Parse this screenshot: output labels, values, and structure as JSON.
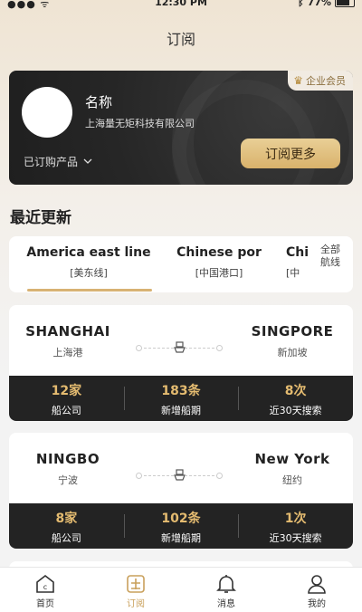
{
  "status_bar": {
    "time": "12:30 PM",
    "battery": "77%"
  },
  "nav": {
    "title": "订阅"
  },
  "member": {
    "badge": "企业会员",
    "name": "名称",
    "company": "上海量无矩科技有限公司",
    "purchased_label": "已订购产品",
    "subscribe_button": "订阅更多"
  },
  "recent": {
    "title": "最近更新",
    "tabs": [
      {
        "en": "America east line",
        "cn": "[美东线]"
      },
      {
        "en": "Chinese por",
        "cn": "[中国港口]"
      },
      {
        "en": "Chi",
        "cn": "[中"
      }
    ],
    "all_routes_label_1": "全部",
    "all_routes_label_2": "航线"
  },
  "routes": [
    {
      "from_en": "SHANGHAI",
      "from_cn": "上海港",
      "to_en": "SINGPORE",
      "to_cn": "新加坡",
      "stats": [
        {
          "num": "12家",
          "label": "船公司"
        },
        {
          "num": "183条",
          "label": "新增船期"
        },
        {
          "num": "8次",
          "label": "近30天搜索"
        }
      ]
    },
    {
      "from_en": "NINGBO",
      "from_cn": "宁波",
      "to_en": "New York",
      "to_cn": "纽约",
      "stats": [
        {
          "num": "8家",
          "label": "船公司"
        },
        {
          "num": "102条",
          "label": "新增船期"
        },
        {
          "num": "1次",
          "label": "近30天搜索"
        }
      ]
    }
  ],
  "tabbar": [
    {
      "label": "首页",
      "icon": "home-icon"
    },
    {
      "label": "订阅",
      "icon": "subscribe-icon"
    },
    {
      "label": "消息",
      "icon": "bell-icon"
    },
    {
      "label": "我的",
      "icon": "user-icon"
    }
  ],
  "colors": {
    "accent": "#d8b273",
    "dark": "#232323",
    "stat_number": "#e4bb70"
  }
}
